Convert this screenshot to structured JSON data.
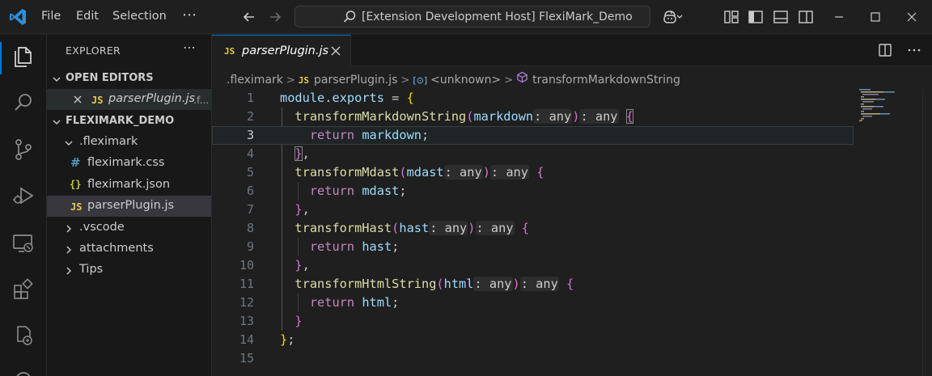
{
  "titlebar": {
    "menu": [
      "File",
      "Edit",
      "Selection"
    ],
    "more": "⋯",
    "search_text": "[Extension Development Host] FlexiMark_Demo"
  },
  "activity": [
    "explorer-icon",
    "search-icon",
    "source-control-icon",
    "run-debug-icon",
    "remote-explorer-icon",
    "extensions-icon",
    "extension-test-icon"
  ],
  "sidebar": {
    "title": "EXPLORER",
    "more": "⋯",
    "open_editors": {
      "label": "OPEN EDITORS",
      "items": [
        {
          "icon_text": "JS",
          "name": "parserPlugin.js",
          "hint": ".f..."
        }
      ]
    },
    "workspace": {
      "label": "FLEXIMARK_DEMO",
      "folder": ".fleximark",
      "files": [
        {
          "icon": "#",
          "name": "fleximark.css"
        },
        {
          "icon": "{}",
          "name": "fleximark.json"
        },
        {
          "icon": "JS",
          "name": "parserPlugin.js"
        }
      ],
      "folders": [
        ".vscode",
        "attachments",
        "Tips"
      ]
    }
  },
  "editor": {
    "tab": {
      "icon_text": "JS",
      "label": "parserPlugin.js"
    },
    "breadcrumb": {
      "folder": ".fleximark",
      "file": "parserPlugin.js",
      "scope": "<unknown>",
      "symbol": "transformMarkdownString",
      "file_icon_text": "JS",
      "scope_icon_text": "[⊙]"
    },
    "line_numbers": [
      "1",
      "2",
      "3",
      "4",
      "5",
      "6",
      "7",
      "8",
      "9",
      "10",
      "11",
      "12",
      "13",
      "14",
      "15"
    ],
    "current_line": 3,
    "code": {
      "module": "module",
      "exports": "exports",
      "f1": "transformMarkdownString",
      "p1": "markdown",
      "f2": "transformMdast",
      "p2": "mdast",
      "f3": "transformHast",
      "p3": "hast",
      "f4": "transformHtmlString",
      "p4": "html",
      "ret": "return",
      "type_hint": ": any"
    }
  }
}
